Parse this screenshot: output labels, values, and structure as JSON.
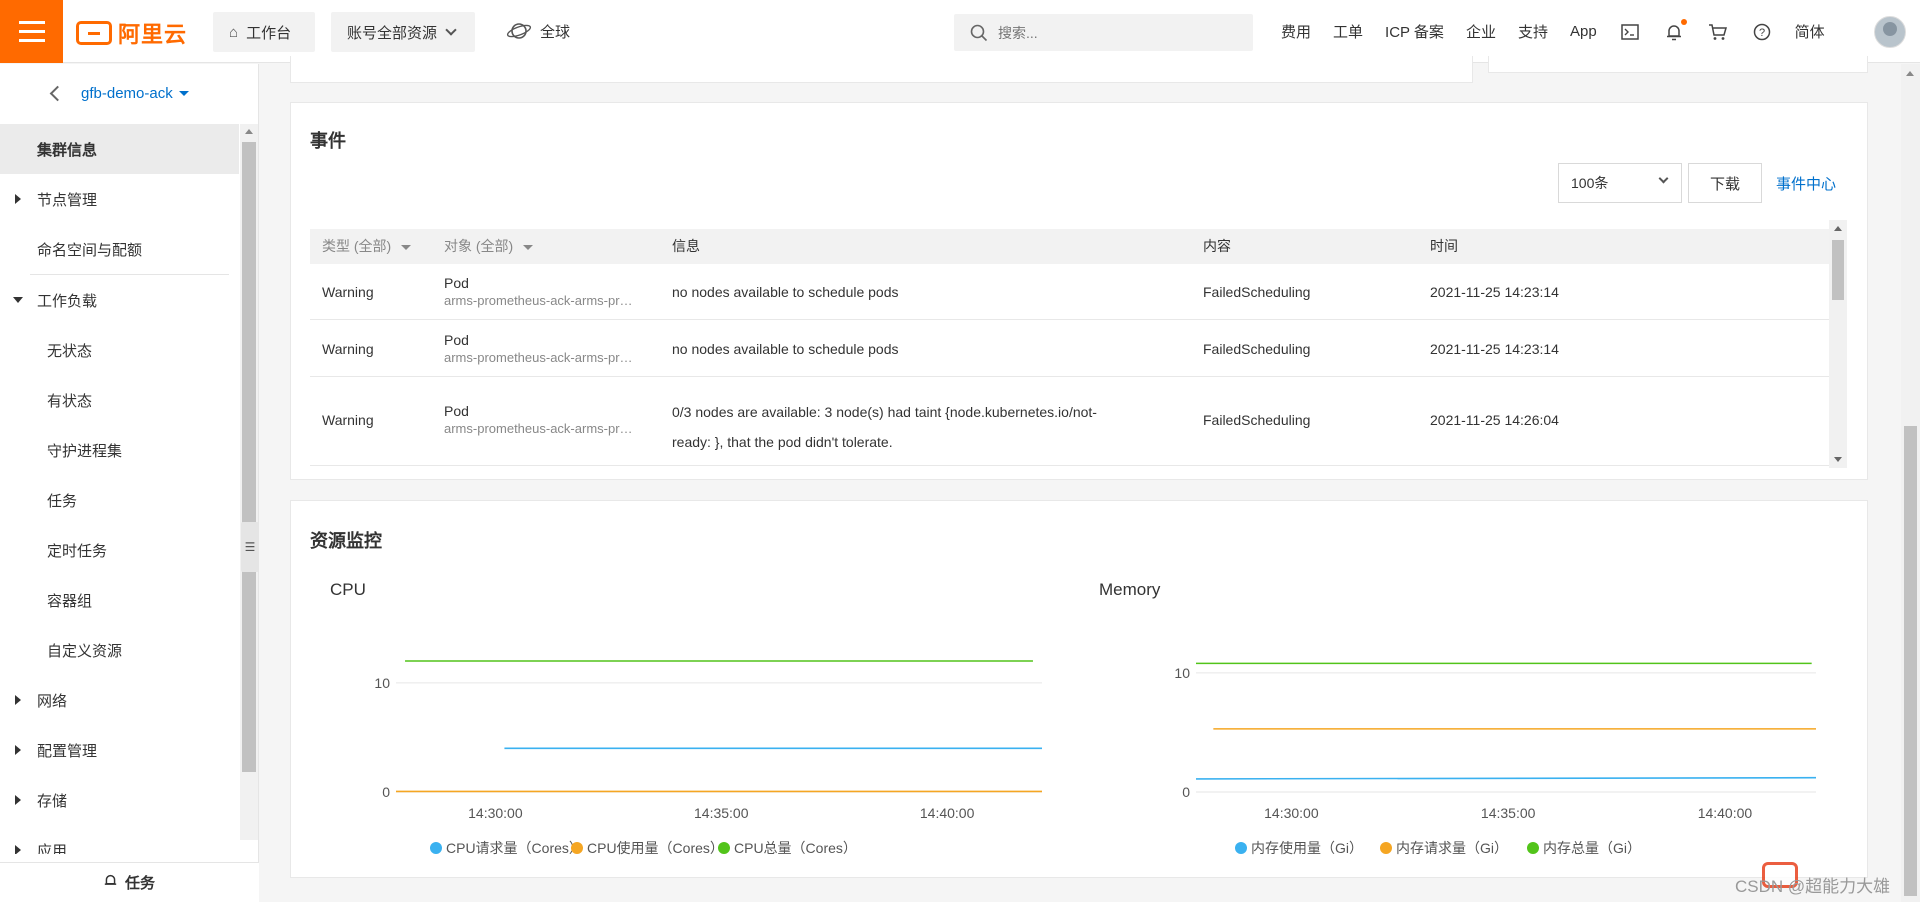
{
  "topbar": {
    "logo_text": "阿里云",
    "workbench": "工作台",
    "account_scope": "账号全部资源",
    "region": "全球",
    "search_placeholder": "搜索...",
    "links": [
      "费用",
      "工单",
      "ICP 备案",
      "企业",
      "支持",
      "App"
    ],
    "lang": "简体",
    "icons": [
      "terminal-icon",
      "bell-icon",
      "cart-icon",
      "help-icon"
    ],
    "brand_color": "#ff6a00"
  },
  "sidebar": {
    "cluster_name": "gfb-demo-ack",
    "items": [
      {
        "label": "集群信息",
        "level": "top",
        "active": true,
        "arrow": "none"
      },
      {
        "label": "节点管理",
        "level": "top",
        "arrow": "right"
      },
      {
        "label": "命名空间与配额",
        "level": "top",
        "arrow": "none"
      },
      {
        "label": "工作负载",
        "level": "top",
        "arrow": "down"
      },
      {
        "label": "无状态",
        "level": "sub"
      },
      {
        "label": "有状态",
        "level": "sub"
      },
      {
        "label": "守护进程集",
        "level": "sub"
      },
      {
        "label": "任务",
        "level": "sub"
      },
      {
        "label": "定时任务",
        "level": "sub"
      },
      {
        "label": "容器组",
        "level": "sub"
      },
      {
        "label": "自定义资源",
        "level": "sub"
      },
      {
        "label": "网络",
        "level": "top",
        "arrow": "right"
      },
      {
        "label": "配置管理",
        "level": "top",
        "arrow": "right"
      },
      {
        "label": "存储",
        "level": "top",
        "arrow": "right"
      },
      {
        "label": "应用",
        "level": "top",
        "arrow": "right"
      }
    ],
    "task_label": "任务"
  },
  "events": {
    "title": "事件",
    "page_size": "100条",
    "download_label": "下载",
    "event_center_label": "事件中心",
    "columns": {
      "type": "类型 (全部)",
      "object": "对象 (全部)",
      "info": "信息",
      "content": "内容",
      "time": "时间"
    },
    "rows": [
      {
        "type": "Warning",
        "object_kind": "Pod",
        "object_name": "arms-prometheus-ack-arms-prometheus",
        "info": "no nodes available to schedule pods",
        "content": "FailedScheduling",
        "time": "2021-11-25 14:23:14"
      },
      {
        "type": "Warning",
        "object_kind": "Pod",
        "object_name": "arms-prometheus-ack-arms-prometheus",
        "info": "no nodes available to schedule pods",
        "content": "FailedScheduling",
        "time": "2021-11-25 14:23:14"
      },
      {
        "type": "Warning",
        "object_kind": "Pod",
        "object_name": "arms-prometheus-ack-arms-prometheus",
        "info_line1": "0/3 nodes are available: 3 node(s) had taint {node.kubernetes.io/not-",
        "info_line2": "ready: }, that the pod didn't tolerate.",
        "content": "FailedScheduling",
        "time": "2021-11-25 14:26:04"
      }
    ]
  },
  "monitor": {
    "title": "资源监控"
  },
  "chart_data": [
    {
      "type": "line",
      "title": "CPU",
      "x_ticks": [
        "14:30:00",
        "14:35:00",
        "14:40:00"
      ],
      "x_range_minutes": [
        27.8,
        42.1
      ],
      "ylim": [
        0,
        12
      ],
      "y_ticks": [
        0,
        10
      ],
      "grid": true,
      "legend_position": "bottom",
      "series": [
        {
          "name": "CPU请求量（Cores）",
          "color": "#3ab1f0",
          "x_start_minutes": 30.2,
          "x_end_minutes": 42.1,
          "values": [
            4,
            4
          ]
        },
        {
          "name": "CPU使用量（Cores）",
          "color": "#f5a623",
          "x_start_minutes": 27.8,
          "x_end_minutes": 42.1,
          "values": [
            0.05,
            0.05
          ]
        },
        {
          "name": "CPU总量（Cores）",
          "color": "#52c41a",
          "x_start_minutes": 28.0,
          "x_end_minutes": 41.9,
          "values": [
            12,
            12
          ]
        }
      ]
    },
    {
      "type": "line",
      "title": "Memory",
      "x_ticks": [
        "14:30:00",
        "14:35:00",
        "14:40:00"
      ],
      "x_range_minutes": [
        27.8,
        42.1
      ],
      "ylim": [
        0,
        11
      ],
      "y_ticks": [
        0,
        10
      ],
      "grid": true,
      "legend_position": "bottom",
      "series": [
        {
          "name": "内存使用量（Gi）",
          "color": "#3ab1f0",
          "x_start_minutes": 27.8,
          "x_end_minutes": 42.1,
          "values": [
            1.1,
            1.2
          ]
        },
        {
          "name": "内存请求量（Gi）",
          "color": "#f5a623",
          "x_start_minutes": 28.2,
          "x_end_minutes": 42.1,
          "values": [
            5.3,
            5.3
          ]
        },
        {
          "name": "内存总量（Gi）",
          "color": "#52c41a",
          "x_start_minutes": 27.8,
          "x_end_minutes": 42.0,
          "values": [
            10.8,
            10.8
          ]
        }
      ]
    }
  ],
  "watermark": "CSDN @超能力大雄"
}
